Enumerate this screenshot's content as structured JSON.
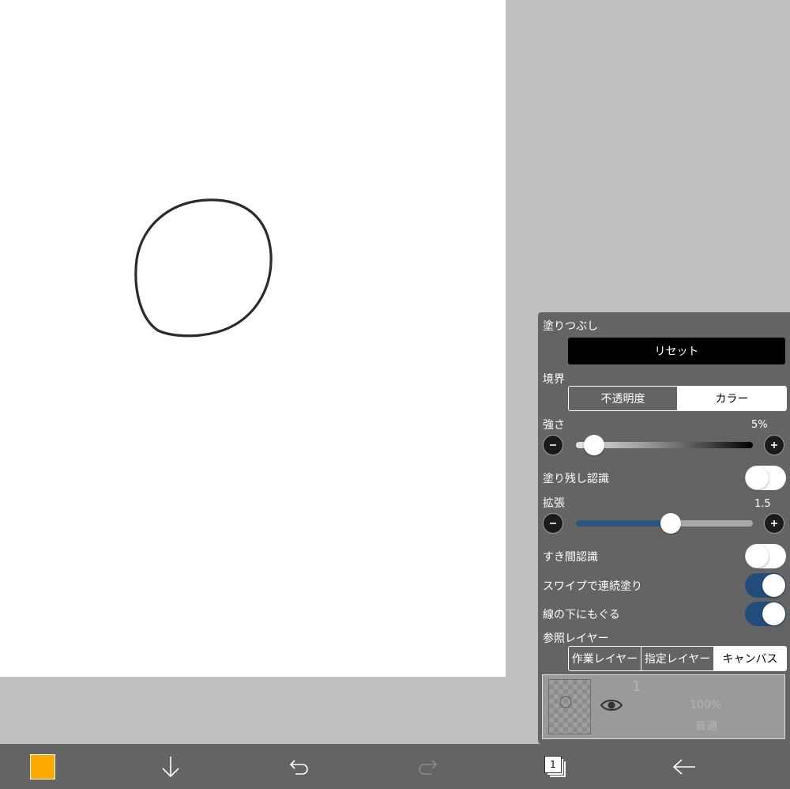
{
  "panel": {
    "title": "塗りつぶし",
    "reset_label": "リセット",
    "boundary": {
      "label": "境界",
      "options": [
        "不透明度",
        "カラー"
      ],
      "selected": "カラー"
    },
    "strength": {
      "label": "強さ",
      "value_text": "5%",
      "value": 0.05
    },
    "leftover_recognition": {
      "label": "塗り残し認識",
      "on": false
    },
    "expand": {
      "label": "拡張",
      "value_text": "1.5",
      "fraction": 0.54
    },
    "gap_recognition": {
      "label": "すき間認識",
      "on": false
    },
    "swipe_fill": {
      "label": "スワイプで連続塗り",
      "on": true
    },
    "under_line": {
      "label": "線の下にもぐる",
      "on": true
    },
    "reference_layer": {
      "label": "参照レイヤー",
      "options": [
        "作業レイヤー",
        "指定レイヤー",
        "キャンバス"
      ],
      "selected": "キャンバス"
    },
    "layer": {
      "number": "1",
      "opacity": "100%",
      "blend": "普通",
      "visible": true
    }
  },
  "toolbar": {
    "color": "#ffa800",
    "layers_count": "1",
    "icons": [
      "color-swatch",
      "down-arrow-icon",
      "undo-icon",
      "redo-icon",
      "layers-icon",
      "back-arrow-icon"
    ]
  },
  "colors": {
    "background": "#bfbfbf",
    "panel": "#646464",
    "toggle_on": "#244c7b",
    "expand_track": "#2d5580"
  }
}
